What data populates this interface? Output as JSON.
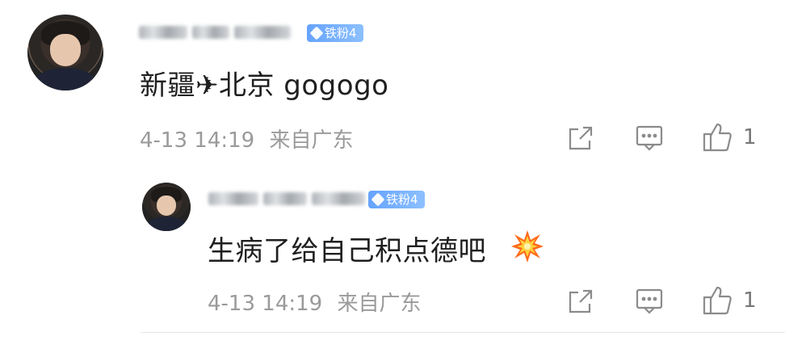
{
  "comments": [
    {
      "badge": "铁粉4",
      "content": "新疆✈北京 gogogo",
      "time": "4-13 14:19",
      "location": "来自广东",
      "like_count": "1",
      "icons": {
        "share": "share-icon",
        "reply": "comment-icon",
        "like": "thumb-up-icon"
      }
    },
    {
      "badge": "铁粉4",
      "content": "生病了给自己积点德吧",
      "time": "4-13 14:19",
      "location": "来自广东",
      "like_count": "1",
      "icons": {
        "share": "share-icon",
        "reply": "comment-icon",
        "like": "thumb-up-icon",
        "emoji": "collision-emoji"
      }
    }
  ],
  "colors": {
    "badge_bg": "#66a3ff",
    "meta_text": "#9a9a9a",
    "icon": "#8b8b8b"
  }
}
